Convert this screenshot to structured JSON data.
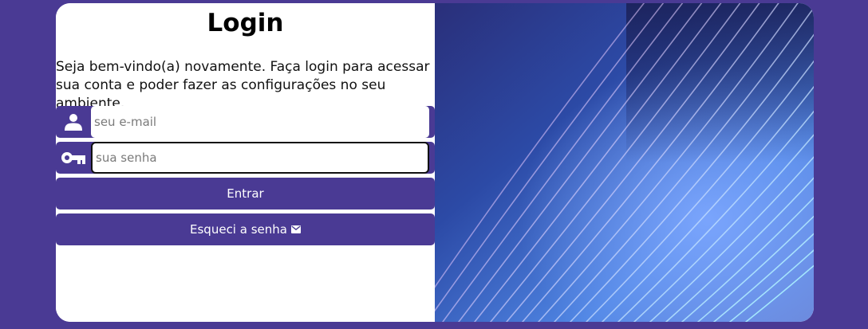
{
  "login": {
    "title": "Login",
    "intro": "Seja bem-vindo(a) novamente. Faça login para acessar sua conta e poder fazer as configurações no seu ambiente.",
    "email": {
      "placeholder": "seu e-mail",
      "value": "",
      "icon": "user-icon"
    },
    "password": {
      "placeholder": "sua senha",
      "value": "",
      "icon": "key-icon"
    },
    "submit_label": "Entrar",
    "forgot_label": "Esqueci a senha",
    "forgot_icon": "mail-icon"
  },
  "colors": {
    "page_background": "#4a3a94",
    "accent": "#4a3a94",
    "card": "#ffffff",
    "button_text": "#ffffff"
  }
}
